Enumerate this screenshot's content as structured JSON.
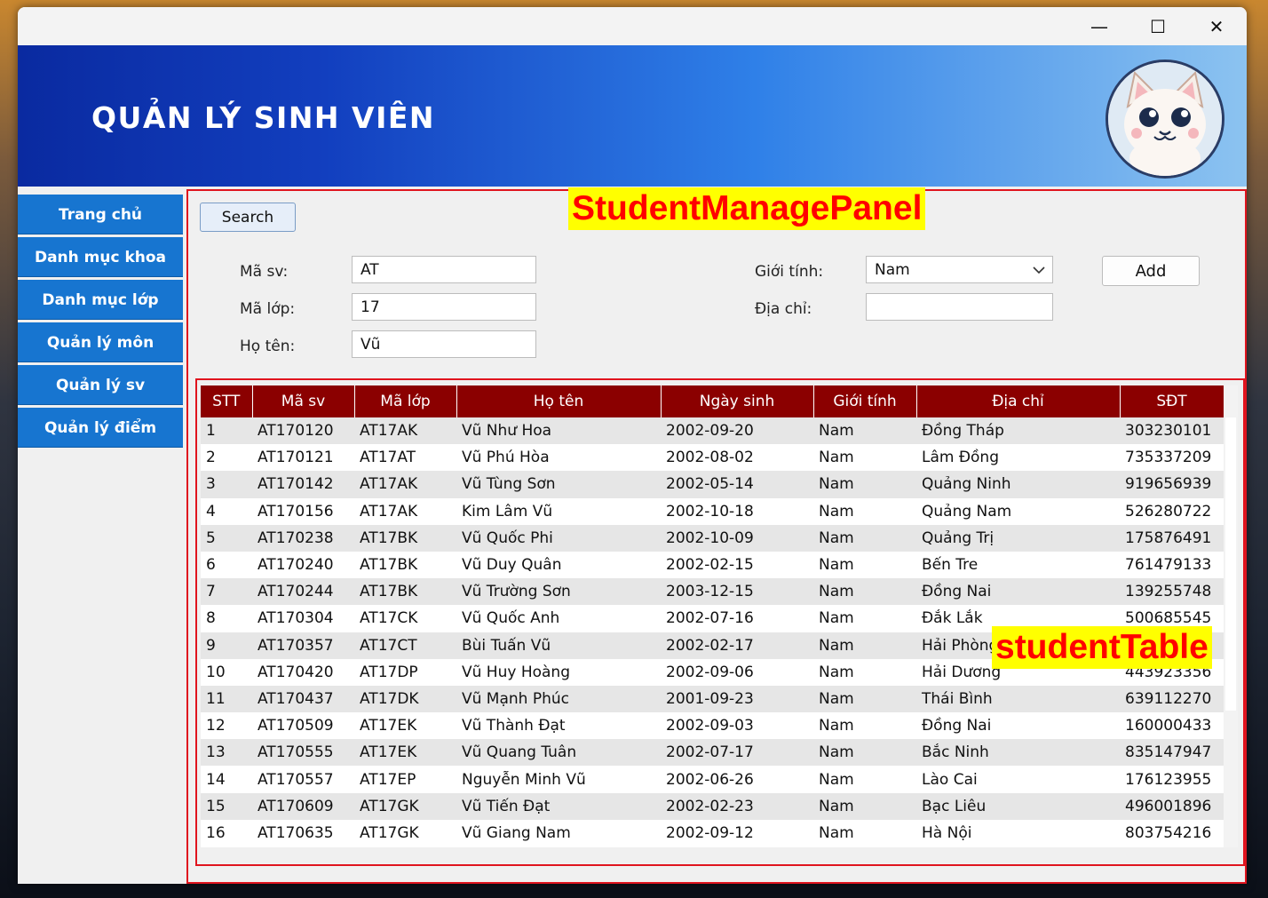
{
  "window": {
    "minimize_glyph": "—",
    "maximize_glyph": "☐",
    "close_glyph": "✕"
  },
  "header": {
    "title": "QUẢN LÝ SINH VIÊN",
    "logo_icon": "cat-avatar-icon"
  },
  "sidebar": {
    "items": [
      {
        "label": "Trang chủ"
      },
      {
        "label": "Danh mục khoa"
      },
      {
        "label": "Danh mục lớp"
      },
      {
        "label": "Quản lý môn"
      },
      {
        "label": "Quản lý sv"
      },
      {
        "label": "Quản lý điểm"
      }
    ]
  },
  "annotations": {
    "panel_tag": "StudentManagePanel",
    "table_tag": "studentTable"
  },
  "form": {
    "search_label": "Search",
    "ma_sv_label": "Mã sv:",
    "ma_sv_value": "AT",
    "ma_lop_label": "Mã lớp:",
    "ma_lop_value": "17",
    "ho_ten_label": "Họ tên:",
    "ho_ten_value": "Vũ",
    "gioi_tinh_label": "Giới tính:",
    "gioi_tinh_value": "Nam",
    "dia_chi_label": "Địa chỉ:",
    "dia_chi_value": "",
    "add_label": "Add"
  },
  "table": {
    "headers": [
      "STT",
      "Mã sv",
      "Mã lớp",
      "Họ tên",
      "Ngày sinh",
      "Giới tính",
      "Địa chỉ",
      "SĐT"
    ],
    "rows": [
      [
        "1",
        "AT170120",
        "AT17AK",
        "Vũ Như Hoa",
        "2002-09-20",
        "Nam",
        "Đồng Tháp",
        "303230101"
      ],
      [
        "2",
        "AT170121",
        "AT17AT",
        "Vũ Phú Hòa",
        "2002-08-02",
        "Nam",
        "Lâm Đồng",
        "735337209"
      ],
      [
        "3",
        "AT170142",
        "AT17AK",
        "Vũ Tùng Sơn",
        "2002-05-14",
        "Nam",
        "Quảng Ninh",
        "919656939"
      ],
      [
        "4",
        "AT170156",
        "AT17AK",
        "Kim Lâm Vũ",
        "2002-10-18",
        "Nam",
        "Quảng Nam",
        "526280722"
      ],
      [
        "5",
        "AT170238",
        "AT17BK",
        "Vũ Quốc Phi",
        "2002-10-09",
        "Nam",
        "Quảng Trị",
        "175876491"
      ],
      [
        "6",
        "AT170240",
        "AT17BK",
        "Vũ Duy Quân",
        "2002-02-15",
        "Nam",
        "Bến Tre",
        "761479133"
      ],
      [
        "7",
        "AT170244",
        "AT17BK",
        "Vũ Trường Sơn",
        "2003-12-15",
        "Nam",
        "Đồng Nai",
        "139255748"
      ],
      [
        "8",
        "AT170304",
        "AT17CK",
        "Vũ Quốc Anh",
        "2002-07-16",
        "Nam",
        "Đắk Lắk",
        "500685545"
      ],
      [
        "9",
        "AT170357",
        "AT17CT",
        "Bùi Tuấn Vũ",
        "2002-02-17",
        "Nam",
        "Hải Phòng",
        ""
      ],
      [
        "10",
        "AT170420",
        "AT17DP",
        "Vũ Huy Hoàng",
        "2002-09-06",
        "Nam",
        "Hải Dương",
        "443923356"
      ],
      [
        "11",
        "AT170437",
        "AT17DK",
        "Vũ Mạnh Phúc",
        "2001-09-23",
        "Nam",
        "Thái Bình",
        "639112270"
      ],
      [
        "12",
        "AT170509",
        "AT17EK",
        "Vũ Thành Đạt",
        "2002-09-03",
        "Nam",
        "Đồng Nai",
        "160000433"
      ],
      [
        "13",
        "AT170555",
        "AT17EK",
        "Vũ Quang Tuân",
        "2002-07-17",
        "Nam",
        "Bắc Ninh",
        "835147947"
      ],
      [
        "14",
        "AT170557",
        "AT17EP",
        "Nguyễn Minh Vũ",
        "2002-06-26",
        "Nam",
        "Lào Cai",
        "176123955"
      ],
      [
        "15",
        "AT170609",
        "AT17GK",
        "Vũ Tiến Đạt",
        "2002-02-23",
        "Nam",
        "Bạc Liêu",
        "496001896"
      ],
      [
        "16",
        "AT170635",
        "AT17GK",
        "Vũ Giang Nam",
        "2002-09-12",
        "Nam",
        "Hà Nội",
        "803754216"
      ]
    ]
  },
  "colors": {
    "header_red": "#8b0000",
    "nav_blue": "#1775d0",
    "annotation_red": "#e0141e",
    "tag_yellow": "#ffff00"
  }
}
